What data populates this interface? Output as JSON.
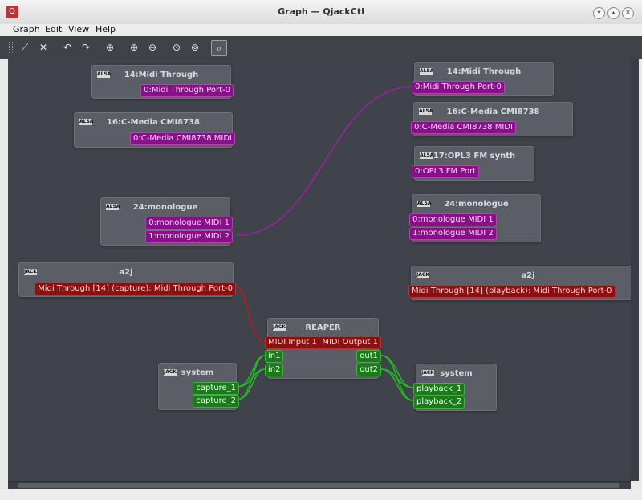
{
  "window": {
    "title": "Graph — QjackCtl",
    "app_icon": "qjackctl-icon"
  },
  "menu": {
    "graph": "Graph",
    "edit": "Edit",
    "view": "View",
    "help": "Help"
  },
  "toolbar": {
    "icons": [
      "connect-icon",
      "disconnect-icon",
      "undo-icon",
      "redo-icon",
      "center-icon",
      "zoom-in-icon",
      "zoom-out-icon",
      "zoom-fit-icon",
      "zoom-reset-icon",
      "zoom-range-icon"
    ]
  },
  "nodes": {
    "alsa_out_through": {
      "title": "14:Midi Through",
      "port": "0:Midi Through Port-0",
      "badge": "ALSA"
    },
    "alsa_out_cmedia": {
      "title": "16:C-Media CMI8738",
      "port": "0:C-Media CMI8738 MIDI",
      "badge": "ALSA"
    },
    "alsa_out_monologue": {
      "title": "24:monologue",
      "port1": "0:monologue MIDI 1",
      "port2": "1:monologue MIDI 2",
      "badge": "ALSA"
    },
    "a2j_out": {
      "title": "a2j",
      "port": "Midi Through [14] (capture): Midi Through Port-0",
      "badge": "JACK"
    },
    "system_out": {
      "title": "system",
      "port1": "capture_1",
      "port2": "capture_2",
      "badge": "JACK"
    },
    "reaper": {
      "title": "REAPER",
      "midi_in": "MIDI Input 1",
      "midi_out": "MIDI Output 1",
      "in1": "in1",
      "in2": "in2",
      "out1": "out1",
      "out2": "out2",
      "badge": "JACK"
    },
    "alsa_in_through": {
      "title": "14:Midi Through",
      "port": "0:Midi Through Port-0",
      "badge": "ALSA"
    },
    "alsa_in_cmedia": {
      "title": "16:C-Media CMI8738",
      "port": "0:C-Media CMI8738 MIDI",
      "badge": "ALSA"
    },
    "alsa_in_opl3": {
      "title": "17:OPL3 FM synth",
      "port": "0:OPL3 FM Port",
      "badge": "ALSA"
    },
    "alsa_in_monologue": {
      "title": "24:monologue",
      "port1": "0:monologue MIDI 1",
      "port2": "1:monologue MIDI 2",
      "badge": "ALSA"
    },
    "a2j_in": {
      "title": "a2j",
      "port": "Midi Through [14] (playback): Midi Through Port-0",
      "badge": "JACK"
    },
    "system_in": {
      "title": "system",
      "port1": "playback_1",
      "port2": "playback_2",
      "badge": "JACK"
    }
  },
  "colors": {
    "canvas": "#40434b",
    "node": "#5b5e67",
    "midi_alsa": "#8b0f8b",
    "midi_jack": "#8c1010",
    "audio": "#1c7a1c",
    "wire_alsa": "#a020a0",
    "wire_midi": "#c01818",
    "wire_audio": "#22bb22"
  }
}
